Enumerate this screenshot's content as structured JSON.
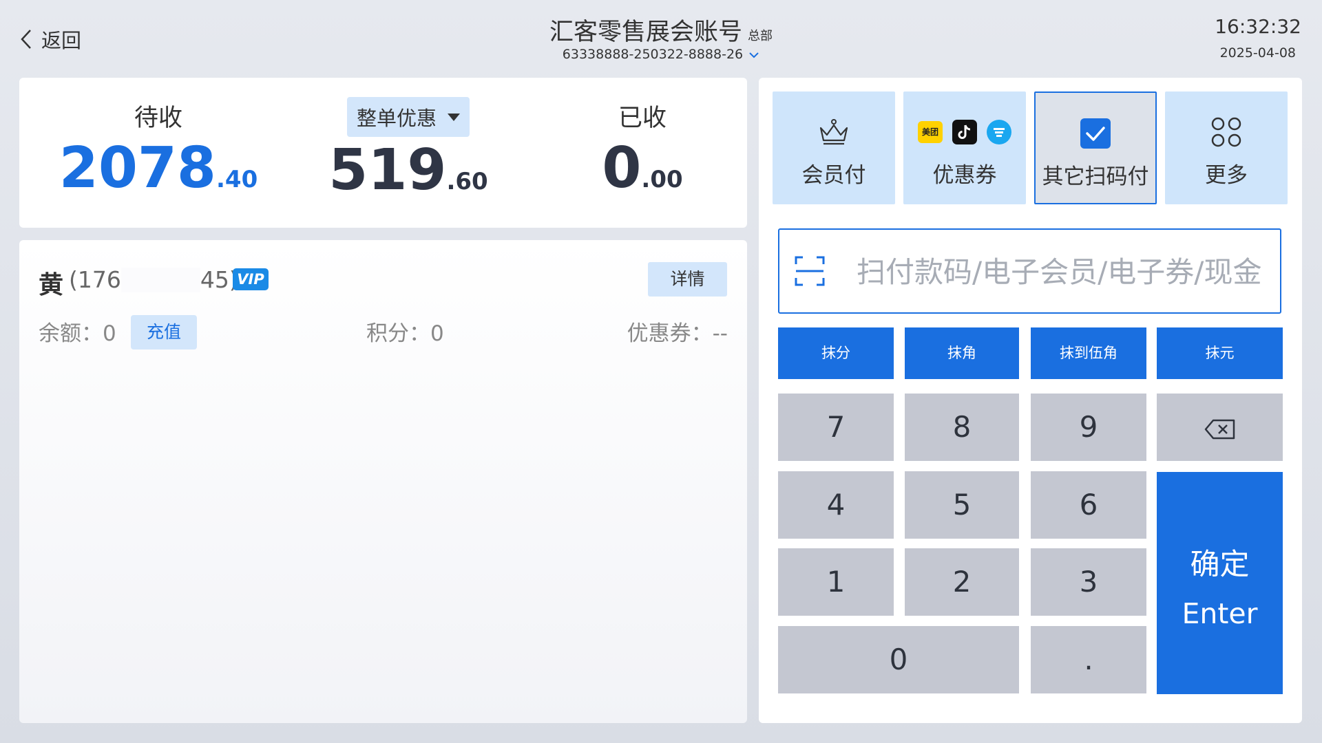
{
  "header": {
    "back_label": "返回",
    "title": "汇客零售展会账号",
    "title_tag": "总部",
    "order_no": "63338888-250322-8888-26",
    "time": "16:32:32",
    "date": "2025-04-08"
  },
  "summary": {
    "pending_label": "待收",
    "pending_int": "2078",
    "pending_dec": ".40",
    "discount_label": "整单优惠",
    "discount_int": "519",
    "discount_dec": ".60",
    "received_label": "已收",
    "received_int": "0",
    "received_dec": ".00"
  },
  "member": {
    "name": "黄",
    "phone_prefix": "(176",
    "phone_suffix": "45)",
    "vip": "VIP",
    "detail_label": "详情",
    "balance_label": "余额：0",
    "recharge_label": "充值",
    "points_label": "积分：0",
    "coupon_label": "优惠券：--"
  },
  "pay_methods": {
    "member": "会员付",
    "coupon": "优惠券",
    "meituan_text": "美团",
    "other_scan": "其它扫码付",
    "more": "更多"
  },
  "input": {
    "placeholder": "扫付款码/电子会员/电子券/现金"
  },
  "rounding": [
    "抹分",
    "抹角",
    "抹到伍角",
    "抹元"
  ],
  "keypad": {
    "k7": "7",
    "k8": "8",
    "k9": "9",
    "k4": "4",
    "k5": "5",
    "k6": "6",
    "k1": "1",
    "k2": "2",
    "k3": "3",
    "k0": "0",
    "kdot": ".",
    "enter_cn": "确定",
    "enter_en": "Enter"
  },
  "colors": {
    "accent": "#1a6fe0",
    "light_accent": "#d3e6fb",
    "key_bg": "#c4c7d1"
  }
}
